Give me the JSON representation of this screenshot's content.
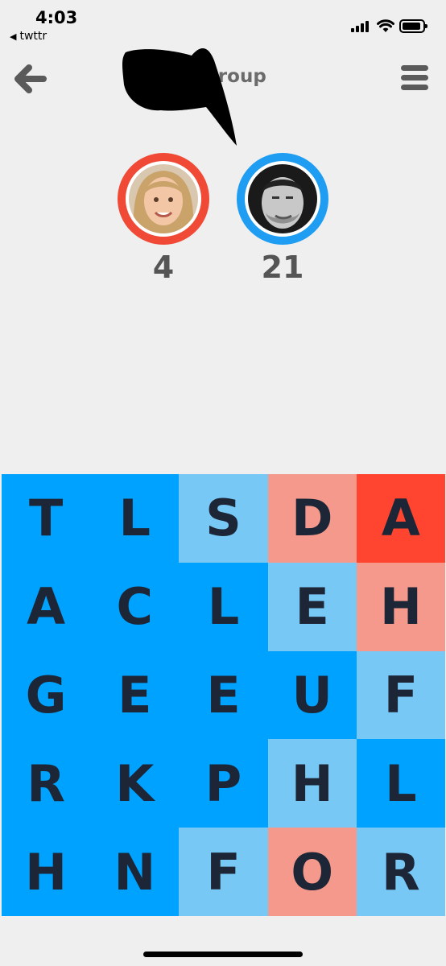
{
  "status_bar": {
    "time": "4:03",
    "back_app_label": "twttr",
    "back_app_arrow": "◀"
  },
  "header": {
    "title": "'s Group"
  },
  "players": [
    {
      "score": "4",
      "ring_color": "#f04a36"
    },
    {
      "score": "21",
      "ring_color": "#1e9df2"
    }
  ],
  "board": {
    "letters": [
      [
        "T",
        "L",
        "S",
        "D",
        "A"
      ],
      [
        "A",
        "C",
        "L",
        "E",
        "H"
      ],
      [
        "G",
        "E",
        "E",
        "U",
        "F"
      ],
      [
        "R",
        "K",
        "P",
        "H",
        "L"
      ],
      [
        "H",
        "N",
        "F",
        "O",
        "R"
      ]
    ],
    "owners": [
      [
        "blue",
        "blue",
        "light-blue",
        "light-red",
        "red"
      ],
      [
        "blue",
        "blue",
        "blue",
        "light-blue",
        "light-red"
      ],
      [
        "blue",
        "blue",
        "blue",
        "blue",
        "light-blue"
      ],
      [
        "blue",
        "blue",
        "blue",
        "light-blue",
        "blue"
      ],
      [
        "blue",
        "blue",
        "light-blue",
        "light-red",
        "light-blue"
      ]
    ],
    "colors": {
      "blue": "#00a2ff",
      "light-blue": "#78c8f5",
      "red": "#ff4530",
      "light-red": "#f5998c"
    }
  },
  "icons": {
    "back": "back-arrow-icon",
    "menu": "hamburger-menu-icon"
  }
}
